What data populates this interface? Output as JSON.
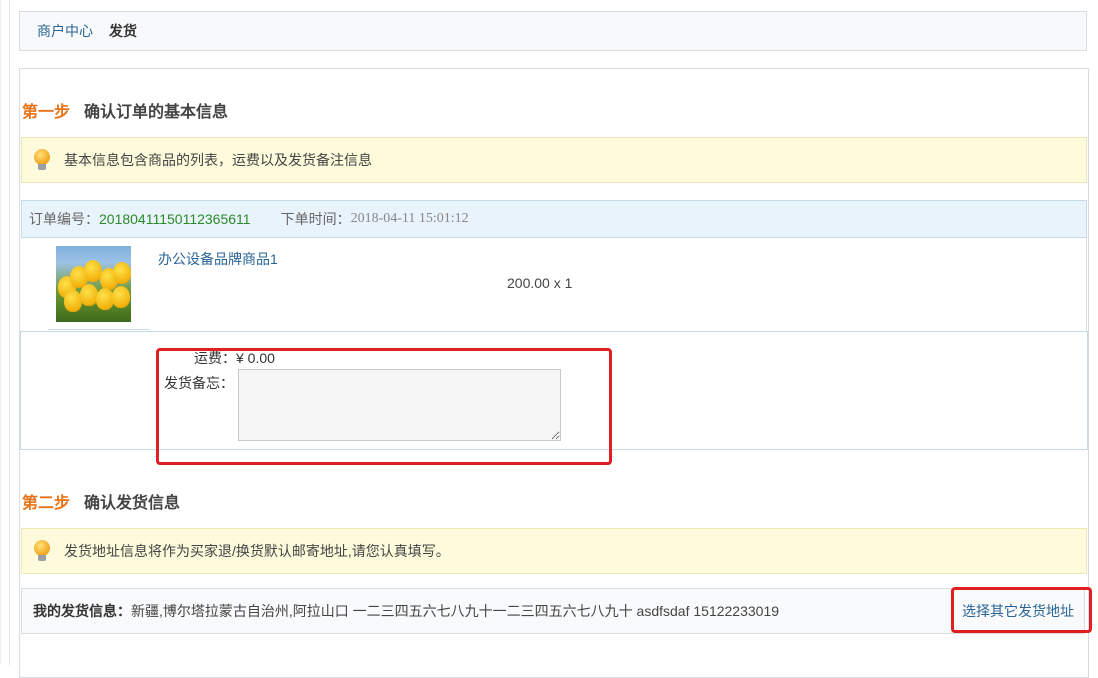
{
  "breadcrumb": {
    "home": "商户中心",
    "current": "发货"
  },
  "step1": {
    "number": "第一步",
    "title": "确认订单的基本信息",
    "tip": "基本信息包含商品的列表，运费以及发货备注信息"
  },
  "order": {
    "no_label": "订单编号：",
    "no_value": "20180411150112365611",
    "time_label": "下单时间：",
    "time_value": "2018-04-11 15:01:12"
  },
  "product": {
    "name": "办公设备品牌商品1",
    "price_qty": "200.00  x 1",
    "thumb_icon": "tulip-image"
  },
  "remark": {
    "freight": "运费：¥ 0.00",
    "label": "发货备忘：",
    "value": ""
  },
  "step2": {
    "number": "第二步",
    "title": "确认发货信息",
    "tip": "发货地址信息将作为买家退/换货默认邮寄地址,请您认真填写。"
  },
  "shipping": {
    "label": "我的发货信息：",
    "value": "新疆,博尔塔拉蒙古自治州,阿拉山口  一二三四五六七八九十一二三四五六七八九十  asdfsdaf  15122233019",
    "change_link": "选择其它发货地址"
  },
  "colors": {
    "accent_orange": "#e8741a",
    "link_blue": "#2a6496",
    "order_green": "#2a8a2a",
    "highlight_red": "#e02020"
  }
}
